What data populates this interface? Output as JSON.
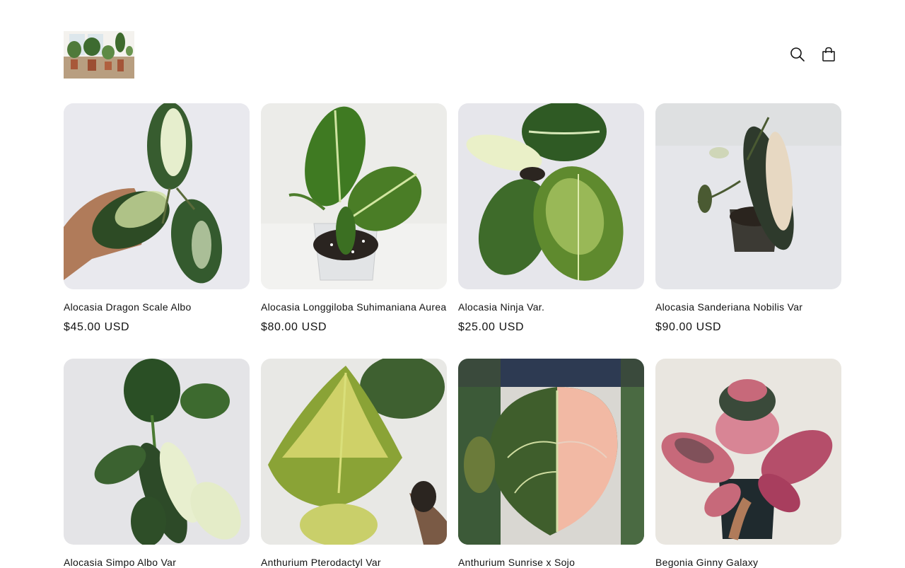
{
  "header": {
    "logo_alt": "store-logo",
    "search_icon": "search-icon",
    "cart_icon": "cart-icon"
  },
  "products": [
    {
      "title": "Alocasia Dragon Scale Albo",
      "price": "$45.00 USD",
      "bg": "#e9e9ee",
      "leaf": "#2f4f2a",
      "accent": "#dfe8b8"
    },
    {
      "title": "Alocasia Longgiloba Suhimaniana Aurea",
      "price": "$80.00 USD",
      "bg": "#ebebe9",
      "leaf": "#3e6e22",
      "accent": "#c8e07a"
    },
    {
      "title": "Alocasia Ninja Var.",
      "price": "$25.00 USD",
      "bg": "#e4e4ea",
      "leaf": "#3f6b2a",
      "accent": "#d9e8a0"
    },
    {
      "title": "Alocasia Sanderiana Nobilis Var",
      "price": "$90.00 USD",
      "bg": "#e6e6ea",
      "leaf": "#2a3a2a",
      "accent": "#e7d8c2"
    },
    {
      "title": "Alocasia Simpo Albo Var",
      "price": "",
      "bg": "#e3e3e6",
      "leaf": "#2d4a28",
      "accent": "#e9f0d0"
    },
    {
      "title": "Anthurium Pterodactyl Var",
      "price": "",
      "bg": "#e6e6e3",
      "leaf": "#556e2a",
      "accent": "#e5e07a"
    },
    {
      "title": "Anthurium Sunrise x Sojo",
      "price": "",
      "bg": "#3d4a3e",
      "leaf": "#3f5e2c",
      "accent": "#f2b9a4"
    },
    {
      "title": "Begonia Ginny Galaxy",
      "price": "",
      "bg": "#e9e6e0",
      "leaf": "#c7697a",
      "accent": "#3a4a3a"
    }
  ]
}
